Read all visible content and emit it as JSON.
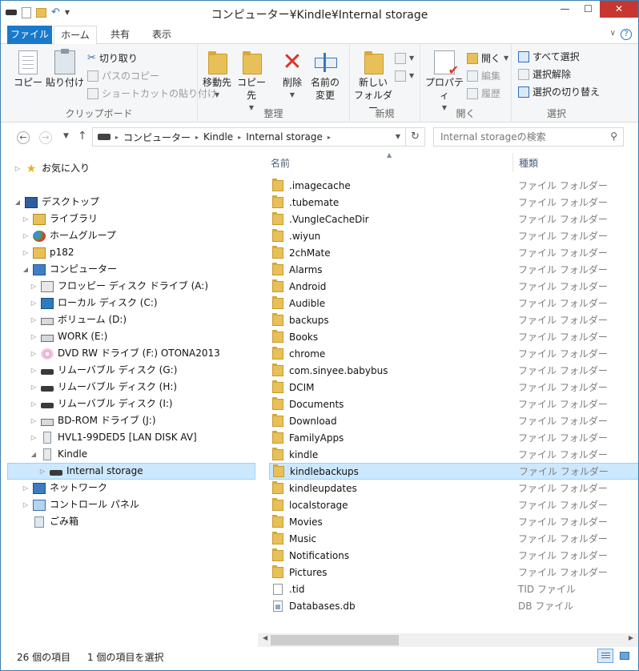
{
  "window": {
    "title": "コンピューター¥Kindle¥Internal storage",
    "minimize": "—",
    "maximize": "☐",
    "close": "✕"
  },
  "tabs": {
    "file": "ファイル",
    "home": "ホーム",
    "share": "共有",
    "view": "表示",
    "help": "?"
  },
  "ribbon": {
    "clipboard": {
      "label": "クリップボード",
      "copy": "コピー",
      "paste": "貼り付け",
      "cut": "切り取り",
      "copy_path": "パスのコピー",
      "paste_shortcut": "ショートカットの貼り付け"
    },
    "organize": {
      "label": "整理",
      "move_to": "移動先",
      "copy_to": "コピー先",
      "delete": "削除",
      "rename_l1": "名前の",
      "rename_l2": "変更"
    },
    "new": {
      "label": "新規",
      "new_folder_l1": "新しい",
      "new_folder_l2": "フォルダー"
    },
    "open": {
      "label": "開く",
      "properties": "プロパティ",
      "open": "開く",
      "edit": "編集",
      "history": "履歴"
    },
    "select": {
      "label": "選択",
      "select_all": "すべて選択",
      "select_none": "選択解除",
      "invert": "選択の切り替え"
    }
  },
  "address": {
    "crumbs": [
      "コンピューター",
      "Kindle",
      "Internal storage"
    ],
    "search_placeholder": "Internal storageの検索"
  },
  "nav": {
    "favorites": "お気に入り",
    "desktop": "デスクトップ",
    "libraries": "ライブラリ",
    "homegroup": "ホームグループ",
    "user": "p182",
    "computer": "コンピューター",
    "floppy": "フロッピー ディスク ドライブ (A:)",
    "local_c": "ローカル ディスク (C:)",
    "volume_d": "ボリューム (D:)",
    "work_e": "WORK (E:)",
    "dvd_f": "DVD RW ドライブ (F:) OTONA2013",
    "removable_g": "リムーバブル ディスク (G:)",
    "removable_h": "リムーバブル ディスク (H:)",
    "removable_i": "リムーバブル ディスク (I:)",
    "bd_j": "BD-ROM ドライブ (J:)",
    "hvl": "HVL1-99DED5 [LAN DISK AV]",
    "kindle": "Kindle",
    "internal": "Internal storage",
    "network": "ネットワーク",
    "control_panel": "コントロール パネル",
    "recycle": "ごみ箱"
  },
  "list": {
    "col_name": "名前",
    "col_type": "種類",
    "items": [
      {
        "name": ".imagecache",
        "type": "ファイル フォルダー"
      },
      {
        "name": ".tubemate",
        "type": "ファイル フォルダー"
      },
      {
        "name": ".VungleCacheDir",
        "type": "ファイル フォルダー"
      },
      {
        "name": ".wiyun",
        "type": "ファイル フォルダー"
      },
      {
        "name": "2chMate",
        "type": "ファイル フォルダー"
      },
      {
        "name": "Alarms",
        "type": "ファイル フォルダー"
      },
      {
        "name": "Android",
        "type": "ファイル フォルダー"
      },
      {
        "name": "Audible",
        "type": "ファイル フォルダー"
      },
      {
        "name": "backups",
        "type": "ファイル フォルダー"
      },
      {
        "name": "Books",
        "type": "ファイル フォルダー"
      },
      {
        "name": "chrome",
        "type": "ファイル フォルダー"
      },
      {
        "name": "com.sinyee.babybus",
        "type": "ファイル フォルダー"
      },
      {
        "name": "DCIM",
        "type": "ファイル フォルダー"
      },
      {
        "name": "Documents",
        "type": "ファイル フォルダー"
      },
      {
        "name": "Download",
        "type": "ファイル フォルダー"
      },
      {
        "name": "FamilyApps",
        "type": "ファイル フォルダー"
      },
      {
        "name": "kindle",
        "type": "ファイル フォルダー"
      },
      {
        "name": "kindlebackups",
        "type": "ファイル フォルダー"
      },
      {
        "name": "kindleupdates",
        "type": "ファイル フォルダー"
      },
      {
        "name": "localstorage",
        "type": "ファイル フォルダー"
      },
      {
        "name": "Movies",
        "type": "ファイル フォルダー"
      },
      {
        "name": "Music",
        "type": "ファイル フォルダー"
      },
      {
        "name": "Notifications",
        "type": "ファイル フォルダー"
      },
      {
        "name": "Pictures",
        "type": "ファイル フォルダー"
      },
      {
        "name": ".tid",
        "type": "TID ファイル"
      },
      {
        "name": "Databases.db",
        "type": "DB ファイル"
      }
    ]
  },
  "status": {
    "count": "26 個の項目",
    "selected": "1 個の項目を選択"
  },
  "colors": {
    "accent": "#1979ca",
    "selection": "#cce8ff",
    "close": "#c7372f"
  }
}
